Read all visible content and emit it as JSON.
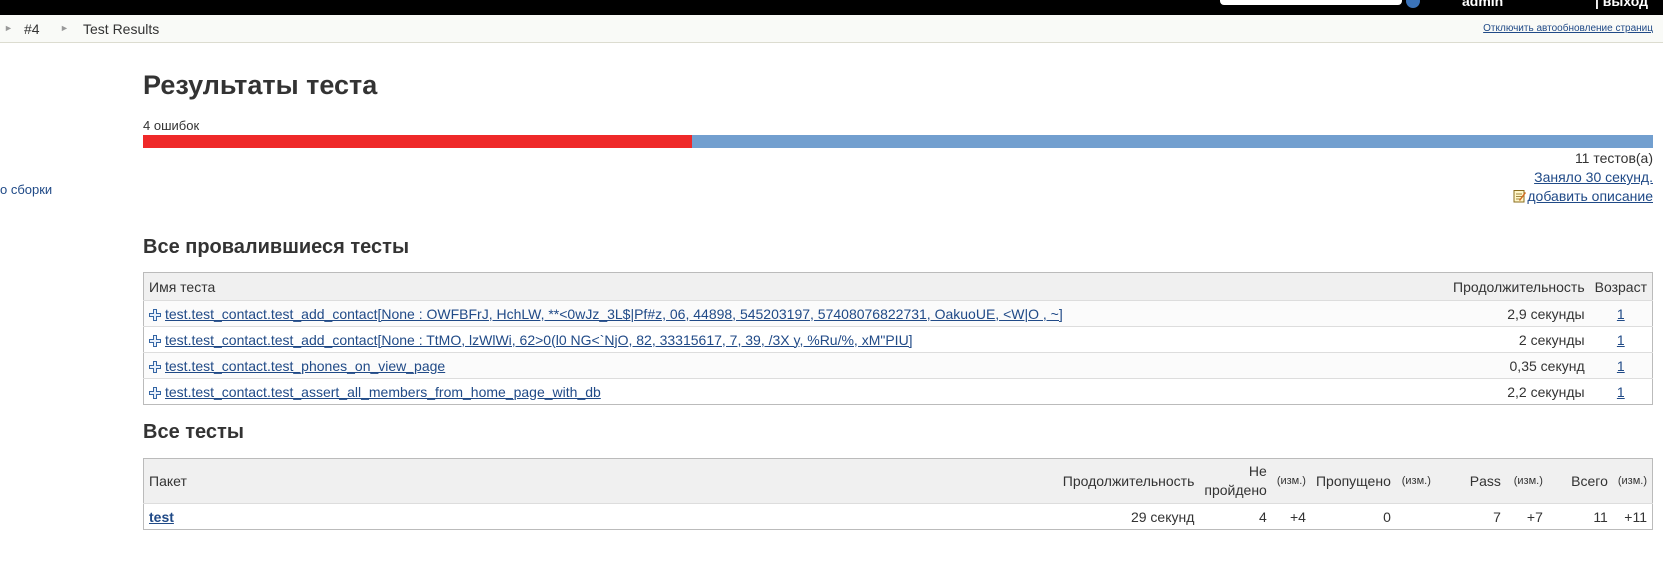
{
  "header": {
    "user": "admin",
    "logout": "| выход"
  },
  "breadcrumb": {
    "build": "#4",
    "page": "Test Results",
    "autorefresh": "Отключить автообновление страниц"
  },
  "sidebar": {
    "partial_link": "о сборки"
  },
  "main": {
    "title": "Результаты теста",
    "fail_count": "4 ошибок",
    "progress": {
      "failed": 4,
      "total": 11
    },
    "tests_total": "11 тестов(а)",
    "duration": "Заняло 30 секунд.",
    "add_description": "добавить описание"
  },
  "failed": {
    "title": "Все провалившиеся тесты",
    "columns": [
      "Имя теста",
      "Продолжительность",
      "Возраст"
    ],
    "rows": [
      {
        "name": "test.test_contact.test_add_contact[None : OWFBFrJ, HchLW, **<0wJz_3L$|Pf#z, 06, 44898, 545203197, 57408076822731, OakuoUE, <W|O , ~]",
        "duration": "2,9 секунды",
        "age": "1"
      },
      {
        "name": "test.test_contact.test_add_contact[None : TtMO, lzWlWi, 62>0(l0 NG<`NjO, 82, 33315617, 7, 39, /3X y, %Ru/%, xM\"PIU]",
        "duration": "2 секунды",
        "age": "1"
      },
      {
        "name": "test.test_contact.test_phones_on_view_page",
        "duration": "0,35 секунд",
        "age": "1"
      },
      {
        "name": "test.test_contact.test_assert_all_members_from_home_page_with_db",
        "duration": "2,2 секунды",
        "age": "1"
      }
    ]
  },
  "all": {
    "title": "Все тесты",
    "columns": {
      "package": "Пакет",
      "duration": "Продолжительность",
      "fail": "Не пройдено",
      "diff": "(изм.)",
      "skip": "Пропущено",
      "pass": "Pass",
      "total": "Всего"
    },
    "rows": [
      {
        "package": "test",
        "duration": "29 секунд",
        "fail": "4",
        "fail_diff": "+4",
        "skip": "0",
        "skip_diff": "",
        "pass": "7",
        "pass_diff": "+7",
        "total": "11",
        "total_diff": "+11"
      }
    ]
  },
  "colors": {
    "fail": "#ef2929",
    "pass": "#729fcf",
    "link": "#204a87"
  }
}
